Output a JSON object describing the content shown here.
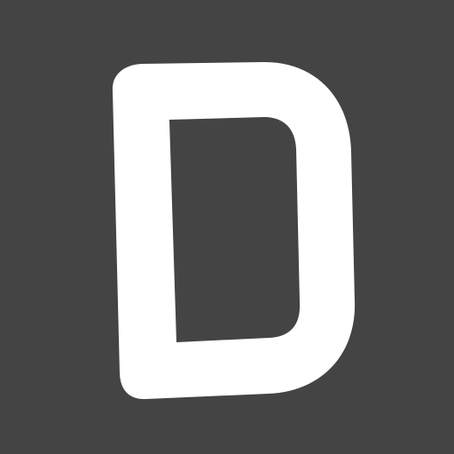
{
  "icon": {
    "name": "D",
    "glyph": "letter-d-logo",
    "background_color": "#444444",
    "glyph_color": "#ffffff"
  }
}
